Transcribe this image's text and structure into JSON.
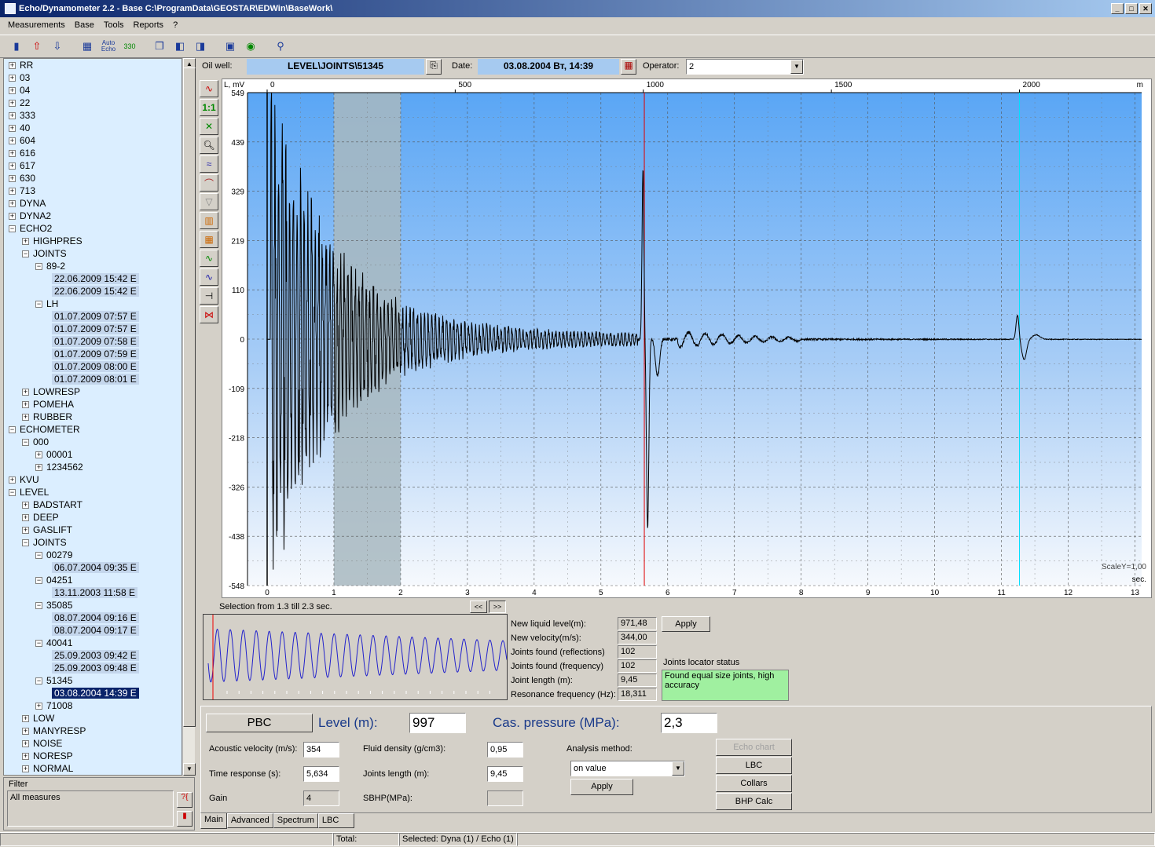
{
  "window": {
    "title": "Echo/Dynamometer 2.2 - Base C:\\ProgramData\\GEOSTAR\\EDWin\\BaseWork\\"
  },
  "menu": [
    "Measurements",
    "Base",
    "Tools",
    "Reports",
    "?"
  ],
  "toolbar": {
    "auto_top": "Auto",
    "auto_bottom": "Echo",
    "icon330": "330"
  },
  "tree": [
    {
      "label": "RR",
      "level": 0,
      "type": "plus"
    },
    {
      "label": "03",
      "level": 0,
      "type": "plus"
    },
    {
      "label": "04",
      "level": 0,
      "type": "plus"
    },
    {
      "label": "22",
      "level": 0,
      "type": "plus"
    },
    {
      "label": "333",
      "level": 0,
      "type": "plus"
    },
    {
      "label": "40",
      "level": 0,
      "type": "plus"
    },
    {
      "label": "604",
      "level": 0,
      "type": "plus"
    },
    {
      "label": "616",
      "level": 0,
      "type": "plus"
    },
    {
      "label": "617",
      "level": 0,
      "type": "plus"
    },
    {
      "label": "630",
      "level": 0,
      "type": "plus"
    },
    {
      "label": "713",
      "level": 0,
      "type": "plus"
    },
    {
      "label": "DYNA",
      "level": 0,
      "type": "plus"
    },
    {
      "label": "DYNA2",
      "level": 0,
      "type": "plus"
    },
    {
      "label": "ECHO2",
      "level": 0,
      "type": "minus"
    },
    {
      "label": "HIGHPRES",
      "level": 1,
      "type": "plus"
    },
    {
      "label": "JOINTS",
      "level": 1,
      "type": "minus"
    },
    {
      "label": "89-2",
      "level": 2,
      "type": "minus"
    },
    {
      "label": "22.06.2009 15:42 E",
      "level": 3,
      "type": "leaf"
    },
    {
      "label": "22.06.2009 15:42 E",
      "level": 3,
      "type": "leaf"
    },
    {
      "label": "LH",
      "level": 2,
      "type": "minus"
    },
    {
      "label": "01.07.2009 07:57 E",
      "level": 3,
      "type": "leaf"
    },
    {
      "label": "01.07.2009 07:57 E",
      "level": 3,
      "type": "leaf"
    },
    {
      "label": "01.07.2009 07:58 E",
      "level": 3,
      "type": "leaf"
    },
    {
      "label": "01.07.2009 07:59 E",
      "level": 3,
      "type": "leaf"
    },
    {
      "label": "01.07.2009 08:00 E",
      "level": 3,
      "type": "leaf"
    },
    {
      "label": "01.07.2009 08:01 E",
      "level": 3,
      "type": "leaf"
    },
    {
      "label": "LOWRESP",
      "level": 1,
      "type": "plus"
    },
    {
      "label": "POMEHA",
      "level": 1,
      "type": "plus"
    },
    {
      "label": "RUBBER",
      "level": 1,
      "type": "plus"
    },
    {
      "label": "ECHOMETER",
      "level": 0,
      "type": "minus"
    },
    {
      "label": "000",
      "level": 1,
      "type": "minus"
    },
    {
      "label": "00001",
      "level": 2,
      "type": "plus"
    },
    {
      "label": "1234562",
      "level": 2,
      "type": "plus"
    },
    {
      "label": "KVU",
      "level": 0,
      "type": "plus"
    },
    {
      "label": "LEVEL",
      "level": 0,
      "type": "minus"
    },
    {
      "label": "BADSTART",
      "level": 1,
      "type": "plus"
    },
    {
      "label": "DEEP",
      "level": 1,
      "type": "plus"
    },
    {
      "label": "GASLIFT",
      "level": 1,
      "type": "plus"
    },
    {
      "label": "JOINTS",
      "level": 1,
      "type": "minus"
    },
    {
      "label": "00279",
      "level": 2,
      "type": "minus"
    },
    {
      "label": "06.07.2004 09:35 E",
      "level": 3,
      "type": "leaf"
    },
    {
      "label": "04251",
      "level": 2,
      "type": "minus"
    },
    {
      "label": "13.11.2003 11:58 E",
      "level": 3,
      "type": "leaf"
    },
    {
      "label": "35085",
      "level": 2,
      "type": "minus"
    },
    {
      "label": "08.07.2004 09:16 E",
      "level": 3,
      "type": "leaf"
    },
    {
      "label": "08.07.2004 09:17 E",
      "level": 3,
      "type": "leaf"
    },
    {
      "label": "40041",
      "level": 2,
      "type": "minus"
    },
    {
      "label": "25.09.2003 09:42 E",
      "level": 3,
      "type": "leaf"
    },
    {
      "label": "25.09.2003 09:48 E",
      "level": 3,
      "type": "leaf"
    },
    {
      "label": "51345",
      "level": 2,
      "type": "minus"
    },
    {
      "label": "03.08.2004 14:39 E",
      "level": 3,
      "type": "leaf",
      "selected": true
    },
    {
      "label": "71008",
      "level": 2,
      "type": "plus"
    },
    {
      "label": "LOW",
      "level": 1,
      "type": "plus"
    },
    {
      "label": "MANYRESP",
      "level": 1,
      "type": "plus"
    },
    {
      "label": "NOISE",
      "level": 1,
      "type": "plus"
    },
    {
      "label": "NORESP",
      "level": 1,
      "type": "plus"
    },
    {
      "label": "NORMAL",
      "level": 1,
      "type": "plus"
    }
  ],
  "filter": {
    "label": "Filter",
    "value": "All measures"
  },
  "header": {
    "oil_well_label": "Oil well:",
    "oil_well": "LEVEL\\JOINTS\\51345",
    "date_label": "Date:",
    "date": "03.08.2004 Вт, 14:39",
    "operator_label": "Operator:",
    "operator": "2"
  },
  "chart_data": {
    "type": "line",
    "y_unit": "L, mV",
    "x_unit_top": "m",
    "x_unit_bottom": "sec.",
    "y_ticks": [
      549,
      439,
      329,
      219,
      110,
      0,
      -109,
      -218,
      -326,
      -438,
      -548
    ],
    "ylim": [
      -548,
      549
    ],
    "x_top_ticks": [
      0,
      500,
      1000,
      1500,
      2000
    ],
    "x_bottom_ticks": [
      0,
      1,
      2,
      3,
      4,
      5,
      6,
      7,
      8,
      9,
      10,
      11,
      12,
      13
    ],
    "xlim_sec": [
      0,
      13.1
    ],
    "selection_sec": [
      1.0,
      2.0
    ],
    "red_marker_sec": 5.65,
    "cyan_marker_sec": 11.27,
    "scale_label": "ScaleY=1,00",
    "series_color": "#000000",
    "signal_description": "decaying echo oscillation from 0 to 5.6 sec, strong reflection at 5.65 sec, small reflection at 11.27 sec"
  },
  "selection_text": "Selection from 1.3 till 2.3 sec.",
  "nav": {
    "prev": "<<",
    "next": ">>"
  },
  "mini_chart": {
    "type": "line",
    "color": "#2222cc",
    "cycles": 23
  },
  "analysis": {
    "rows": [
      {
        "label": "New liquid level(m):",
        "value": "971,48"
      },
      {
        "label": "New velocity(m/s):",
        "value": "344,00"
      },
      {
        "label": "Joints found (reflections)",
        "value": "102"
      },
      {
        "label": "Joints found (frequency)",
        "value": "102"
      },
      {
        "label": "Joint length  (m):",
        "value": "9,45"
      },
      {
        "label": "Resonance frequency (Hz):",
        "value": "18,311"
      }
    ],
    "apply": "Apply",
    "status_label": "Joints locator status",
    "status_text": "Found equal size joints, high accuracy"
  },
  "main": {
    "pbc": "PBC",
    "level_label": "Level (m):",
    "level": "997",
    "cas_label": "Cas. pressure (MPa):",
    "cas": "2,3",
    "acoustic_label": "Acoustic velocity (m/s):",
    "acoustic": "354",
    "time_label": "Time response (s):",
    "time": "5,634",
    "gain_label": "Gain",
    "gain": "4",
    "fluid_label": "Fluid density (g/cm3):",
    "fluid": "0,95",
    "joints_label": "Joints length (m):",
    "joints": "9,45",
    "sbhp_label": "SBHP(MPa):",
    "sbhp": "",
    "analysis_label": "Analysis method:",
    "analysis_value": "on value",
    "apply": "Apply",
    "buttons": [
      "Echo chart",
      "LBC",
      "Collars",
      "BHP Calc"
    ]
  },
  "tabs": [
    "Main",
    "Advanced",
    "Spectrum",
    "LBC"
  ],
  "status": {
    "total": "Total:",
    "selected": "Selected: Dyna (1) / Echo (1)"
  }
}
